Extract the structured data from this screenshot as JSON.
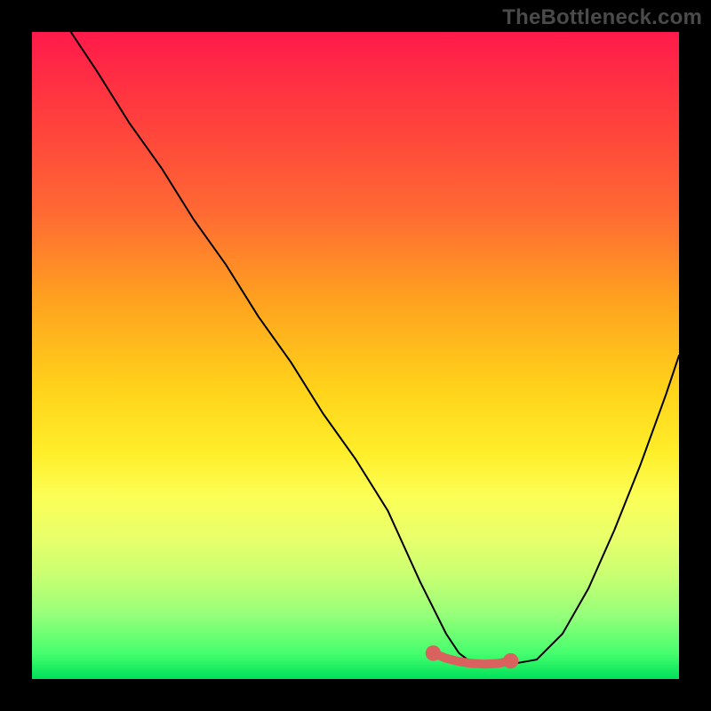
{
  "watermark": "TheBottleneck.com",
  "chart_data": {
    "type": "line",
    "title": "",
    "xlabel": "",
    "ylabel": "",
    "xlim": [
      0,
      100
    ],
    "ylim": [
      0,
      100
    ],
    "grid": false,
    "legend": false,
    "series": [
      {
        "name": "bottleneck-curve",
        "color": "#000000",
        "x": [
          6,
          10,
          15,
          20,
          25,
          30,
          35,
          40,
          45,
          50,
          55,
          60,
          62,
          64,
          66,
          68,
          70,
          72,
          74,
          78,
          82,
          86,
          90,
          94,
          98,
          100
        ],
        "values": [
          100,
          94,
          86,
          79,
          71,
          64,
          56,
          49,
          41,
          34,
          26,
          15,
          11,
          7,
          4,
          2.5,
          2,
          2,
          2.3,
          3,
          7,
          14,
          23,
          33,
          44,
          50
        ]
      },
      {
        "name": "optimal-segment",
        "color": "#d9625f",
        "x": [
          62,
          64,
          66,
          68,
          70,
          72,
          74
        ],
        "values": [
          4,
          3.2,
          2.7,
          2.4,
          2.3,
          2.4,
          2.8
        ]
      }
    ],
    "markers": [
      {
        "name": "optimal-start-dot",
        "x": 62,
        "y": 4,
        "r": 1.2,
        "color": "#d9625f"
      },
      {
        "name": "optimal-end-dot",
        "x": 74,
        "y": 2.8,
        "r": 1.2,
        "color": "#d9625f"
      }
    ],
    "gradient_stops": [
      {
        "pos": 0,
        "color": "#ff1a4b"
      },
      {
        "pos": 12,
        "color": "#ff3b3e"
      },
      {
        "pos": 28,
        "color": "#ff6a33"
      },
      {
        "pos": 42,
        "color": "#ffa41f"
      },
      {
        "pos": 55,
        "color": "#ffd21a"
      },
      {
        "pos": 65,
        "color": "#ffee2a"
      },
      {
        "pos": 72,
        "color": "#fbff57"
      },
      {
        "pos": 78,
        "color": "#e9ff6a"
      },
      {
        "pos": 84,
        "color": "#c9ff72"
      },
      {
        "pos": 90,
        "color": "#97ff7a"
      },
      {
        "pos": 96,
        "color": "#46ff6e"
      },
      {
        "pos": 100,
        "color": "#00e05a"
      }
    ]
  }
}
